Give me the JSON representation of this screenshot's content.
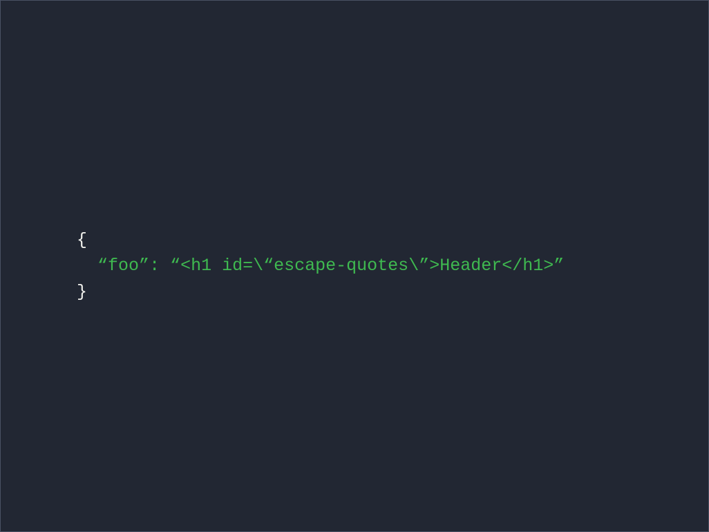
{
  "code": {
    "line1": "{",
    "line2_indent": "  ",
    "line2_key_open": "“",
    "line2_key": "foo",
    "line2_key_close": "”",
    "line2_colon": ": ",
    "line2_val_open": "“",
    "line2_val_part1": "<h1 id=",
    "line2_esc1": "\\",
    "line2_val_part2": "“escape-quotes",
    "line2_esc2": "\\",
    "line2_val_part3": "”>Header</h1>",
    "line2_val_close": "”",
    "line3": "}"
  }
}
